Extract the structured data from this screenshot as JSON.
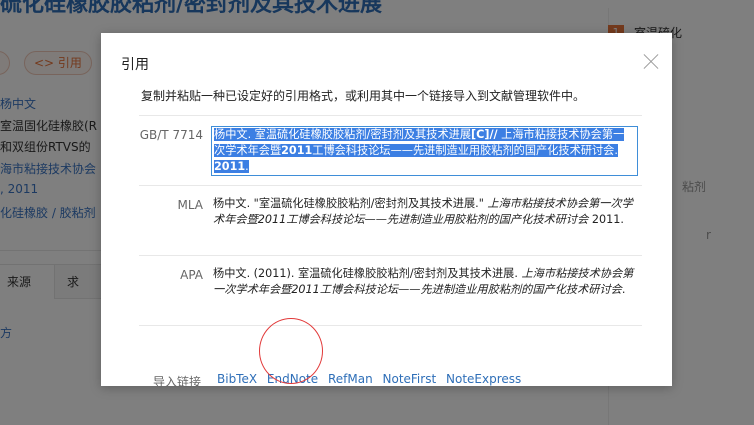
{
  "background": {
    "title": "硫化硅橡胶胶粘剂/密封剂及其技术进展",
    "pills": [
      "",
      "<> 引用"
    ],
    "lines": [
      "杨中文",
      "室温固化硅橡胶(R",
      "和双组份RTVS的",
      "海市粘接技术协会",
      ", 2011",
      "化硅橡胶 / 胶粘剂",
      "方"
    ],
    "tabs": [
      "来源",
      "求"
    ],
    "right_panel": {
      "num": "1",
      "heading": "室温硫化",
      "items": [
        "粘剂",
        "r"
      ]
    }
  },
  "modal": {
    "title": "引用",
    "description": "复制并粘贴一种已设定好的引用格式，或利用其中一个链接导入到文献管理软件中。",
    "citations": [
      {
        "label": "GB/T 7714",
        "segments": [
          {
            "text": "杨中文. 室温硫化硅橡胶胶粘剂/密封剂及其技术进展",
            "style": "normal"
          },
          {
            "text": "[C]//",
            "style": "bold"
          },
          {
            "text": " 上海市粘接技术协会第一次学术年会暨",
            "style": "normal"
          },
          {
            "text": "2011",
            "style": "bold"
          },
          {
            "text": "工博会科技论坛——先进制造业用胶粘剂的国产化技术研讨会. ",
            "style": "normal"
          },
          {
            "text": "2011",
            "style": "bold"
          },
          {
            "text": ".",
            "style": "normal"
          }
        ]
      },
      {
        "label": "MLA",
        "segments": [
          {
            "text": "杨中文. \"室温硫化硅橡胶胶粘剂/密封剂及其技术进展.\" ",
            "style": "normal"
          },
          {
            "text": "上海市粘接技术协会第一次学术年会暨2011工博会科技论坛——先进制造业用胶粘剂的国产化技术研讨会",
            "style": "italic"
          },
          {
            "text": " 2011.",
            "style": "normal"
          }
        ]
      },
      {
        "label": "APA",
        "segments": [
          {
            "text": "杨中文. (2011). 室温硫化硅橡胶胶粘剂/密封剂及其技术进展. ",
            "style": "normal"
          },
          {
            "text": "上海市粘接技术协会第一次学术年会暨2011工博会科技论坛——先进制造业用胶粘剂的国产化技术研讨会",
            "style": "italic"
          },
          {
            "text": ".",
            "style": "normal"
          }
        ]
      }
    ],
    "export": {
      "label": "导入链接",
      "links": [
        "BibTeX",
        "EndNote",
        "RefMan",
        "NoteFirst",
        "NoteExpress"
      ]
    }
  },
  "colors": {
    "accent": "#e8743b",
    "link": "#2f6fb8",
    "selection": "#3c7fe3",
    "annotation": "#e23a3a"
  }
}
